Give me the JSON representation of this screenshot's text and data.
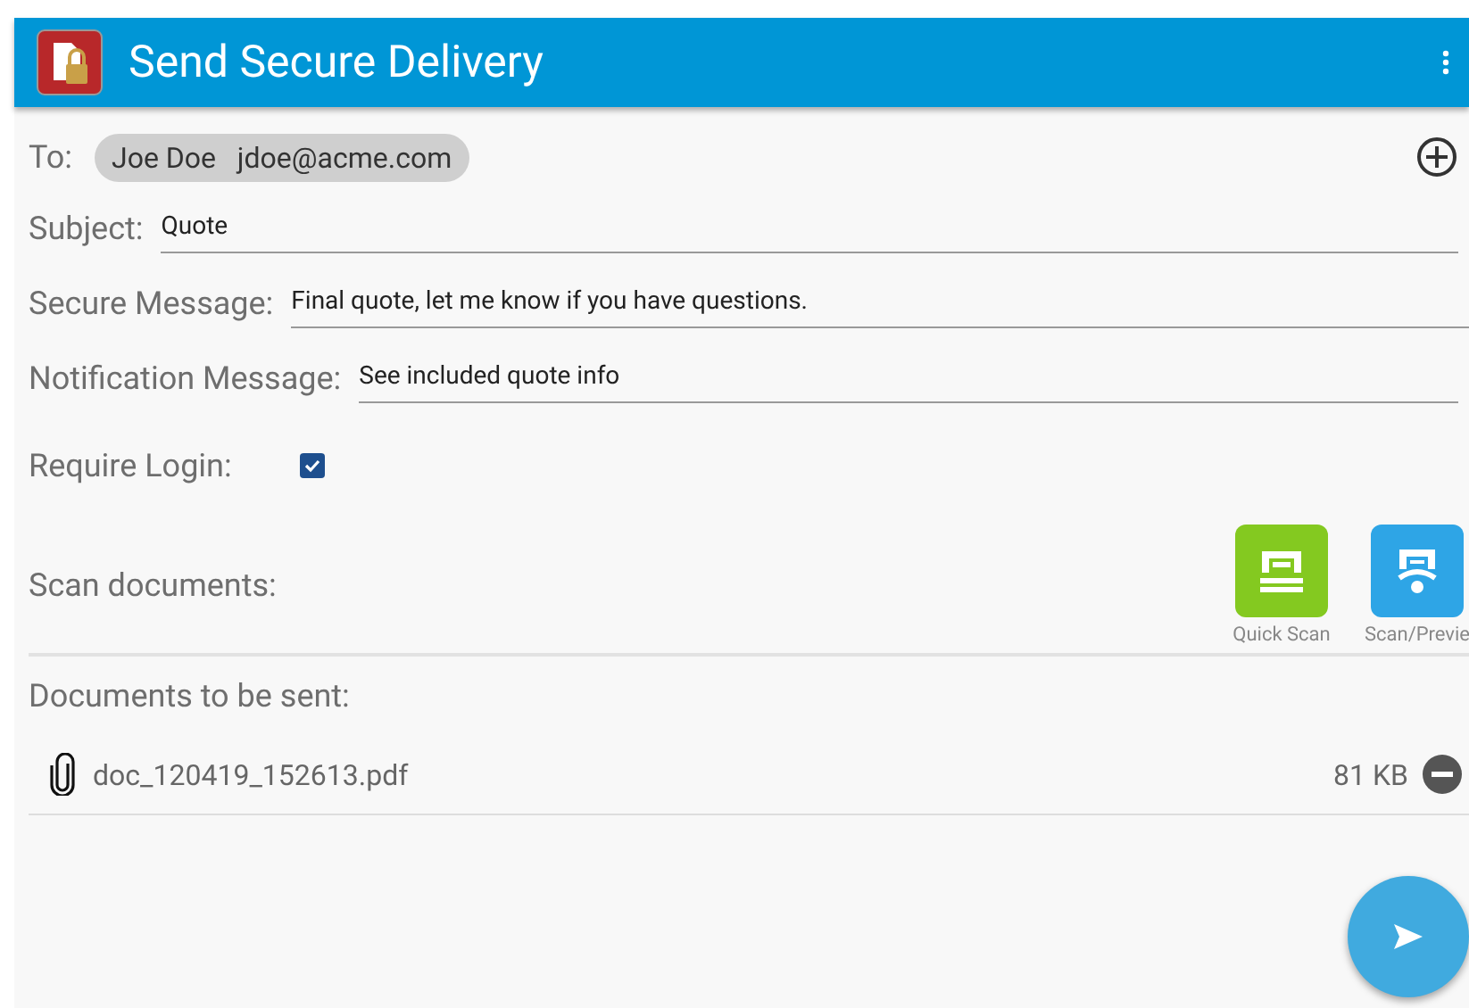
{
  "app_bar": {
    "title": "Send Secure Delivery"
  },
  "to": {
    "label": "To:",
    "recipients": [
      {
        "name": "Joe Doe",
        "email": "jdoe@acme.com"
      }
    ]
  },
  "fields": [
    {
      "label": "Subject:",
      "value": "Quote"
    },
    {
      "label": "Secure Message:",
      "value": "Final quote, let me know if you have questions."
    },
    {
      "label": "Notification Message:",
      "value": "See included quote info"
    }
  ],
  "require_login": {
    "label": "Require Login:",
    "checked": true
  },
  "scan": {
    "label": "Scan documents:",
    "buttons": [
      {
        "kind": "quick",
        "label": "Quick Scan"
      },
      {
        "kind": "preview",
        "label": "Scan/Previe"
      }
    ]
  },
  "documents": {
    "label": "Documents to be sent:",
    "items": [
      {
        "name": "doc_120419_152613.pdf",
        "size": "81 KB"
      }
    ]
  }
}
